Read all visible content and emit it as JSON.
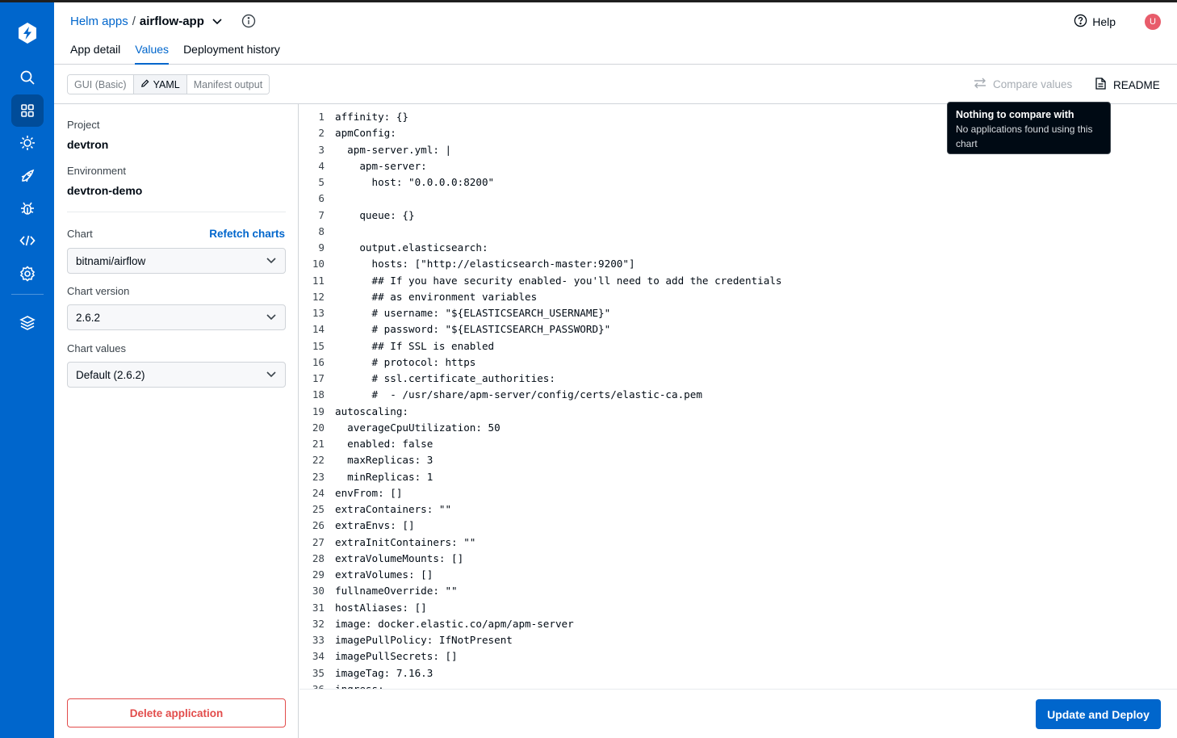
{
  "header": {
    "breadcrumb_parent": "Helm apps",
    "breadcrumb_separator": "/",
    "app_name": "airflow-app",
    "help_label": "Help",
    "avatar_initial": "U",
    "tabs": [
      {
        "label": "App detail",
        "active": false
      },
      {
        "label": "Values",
        "active": true
      },
      {
        "label": "Deployment history",
        "active": false
      }
    ]
  },
  "nav": {
    "icons": [
      "devtron-logo-icon",
      "search-icon",
      "apps-grid-icon",
      "chart-store-icon",
      "deploy-rocket-icon",
      "security-bug-icon",
      "code-icon",
      "settings-gear-icon",
      "stack-layers-icon"
    ],
    "active": "apps-grid-icon"
  },
  "toolbar": {
    "modes": [
      "GUI (Basic)",
      "YAML",
      "Manifest output"
    ],
    "active_mode": "YAML",
    "compare_label": "Compare values",
    "readme_label": "README"
  },
  "tooltip": {
    "title": "Nothing to compare with",
    "body": "No applications found using this chart"
  },
  "panel": {
    "project_label": "Project",
    "project_value": "devtron",
    "environment_label": "Environment",
    "environment_value": "devtron-demo",
    "chart_label": "Chart",
    "refetch_label": "Refetch charts",
    "chart_value": "bitnami/airflow",
    "chart_version_label": "Chart version",
    "chart_version_value": "2.6.2",
    "chart_values_label": "Chart values",
    "chart_values_value": "Default (2.6.2)",
    "delete_label": "Delete application"
  },
  "editor": {
    "lines": [
      "affinity: {}",
      "apmConfig:",
      "  apm-server.yml: |",
      "    apm-server:",
      "      host: \"0.0.0.0:8200\"",
      "",
      "    queue: {}",
      "",
      "    output.elasticsearch:",
      "      hosts: [\"http://elasticsearch-master:9200\"]",
      "      ## If you have security enabled- you'll need to add the credentials",
      "      ## as environment variables",
      "      # username: \"${ELASTICSEARCH_USERNAME}\"",
      "      # password: \"${ELASTICSEARCH_PASSWORD}\"",
      "      ## If SSL is enabled",
      "      # protocol: https",
      "      # ssl.certificate_authorities:",
      "      #  - /usr/share/apm-server/config/certs/elastic-ca.pem",
      "autoscaling:",
      "  averageCpuUtilization: 50",
      "  enabled: false",
      "  maxReplicas: 3",
      "  minReplicas: 1",
      "envFrom: []",
      "extraContainers: \"\"",
      "extraEnvs: []",
      "extraInitContainers: \"\"",
      "extraVolumeMounts: []",
      "extraVolumes: []",
      "fullnameOverride: \"\"",
      "hostAliases: []",
      "image: docker.elastic.co/apm/apm-server",
      "imagePullPolicy: IfNotPresent",
      "imagePullSecrets: []",
      "imageTag: 7.16.3",
      "ingress:"
    ]
  },
  "footer": {
    "deploy_label": "Update and Deploy"
  },
  "colors": {
    "primary": "#0066cc",
    "nav_active": "#004c99",
    "danger": "#e24c4b",
    "tooltip_bg": "#000a14"
  }
}
